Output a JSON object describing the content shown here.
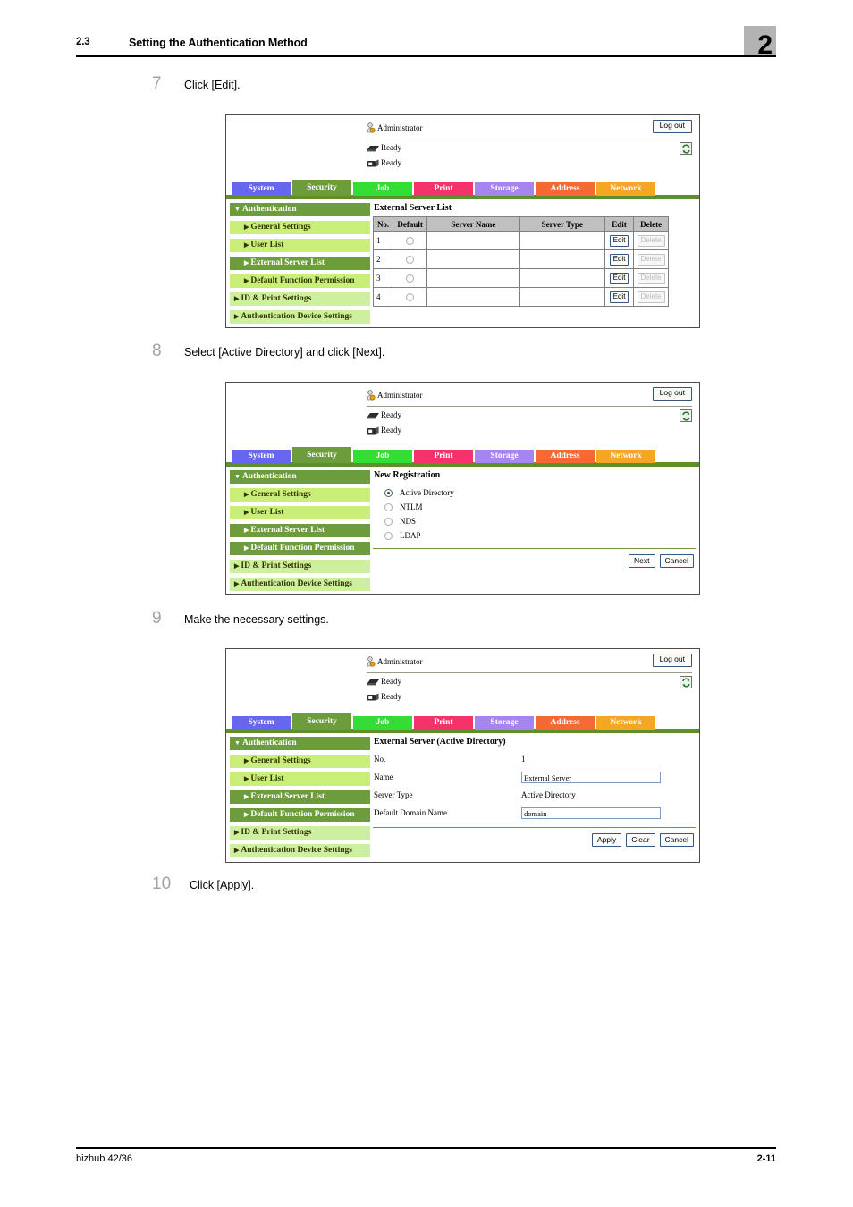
{
  "header": {
    "section_number": "2.3",
    "section_title": "Setting the Authentication Method",
    "chapter_badge": "2"
  },
  "footer": {
    "product": "bizhub 42/36",
    "page_number": "2-11"
  },
  "colors": {
    "tab_system": "#6666ee",
    "tab_security": "#6d9c3c",
    "tab_job": "#33dd33",
    "tab_print": "#f5336b",
    "tab_storage": "#a884f0",
    "tab_address": "#f56a33",
    "tab_network": "#f5a623",
    "nav_active": "#6d9c3c",
    "nav_child": "#c9ef7a",
    "nav_parent": "#cdf0a0",
    "green_bar": "#5f8f2c",
    "table_header": "#c0c0c0"
  },
  "steps": [
    {
      "number": "7",
      "text": "Click [Edit]."
    },
    {
      "number": "8",
      "text": "Select [Active Directory] and click [Next]."
    },
    {
      "number": "9",
      "text": "Make the necessary settings."
    },
    {
      "number": "10",
      "text": "Click [Apply]."
    }
  ],
  "web_ui": {
    "user_label": "Administrator",
    "logout_label": "Log out",
    "status_lines": [
      "Ready",
      "Ready"
    ],
    "tabs": [
      {
        "label": "System",
        "color": "#6666ee",
        "selected": false
      },
      {
        "label": "Security",
        "color": "#6d9c3c",
        "selected": true
      },
      {
        "label": "Job",
        "color": "#33dd33",
        "selected": false
      },
      {
        "label": "Print",
        "color": "#f5336b",
        "selected": false
      },
      {
        "label": "Storage",
        "color": "#a884f0",
        "selected": false
      },
      {
        "label": "Address",
        "color": "#f56a33",
        "selected": false
      },
      {
        "label": "Network",
        "color": "#f5a623",
        "selected": false
      }
    ],
    "nav": [
      {
        "label": "Authentication",
        "level": "root",
        "caret": "▼",
        "active": true
      },
      {
        "label": "General Settings",
        "level": "child",
        "caret": "▶",
        "active": false
      },
      {
        "label": "User List",
        "level": "child",
        "caret": "▶",
        "active": false
      },
      {
        "label": "External Server List",
        "level": "child",
        "caret": "▶",
        "active": true
      },
      {
        "label": "Default Function Permission",
        "level": "child",
        "caret": "▶",
        "active": false
      },
      {
        "label": "ID & Print Settings",
        "level": "parent",
        "caret": "▶",
        "active": false
      },
      {
        "label": "Authentication Device Settings",
        "level": "parent",
        "caret": "▶",
        "active": false
      }
    ]
  },
  "screen7": {
    "panel_title": "External Server List",
    "columns": [
      "No.",
      "Default",
      "Server Name",
      "Server Type",
      "Edit",
      "Delete"
    ],
    "rows": [
      {
        "no": "1",
        "default_selected": false,
        "server_name": "",
        "server_type": "",
        "edit": "Edit",
        "delete": "Delete",
        "delete_disabled": true
      },
      {
        "no": "2",
        "default_selected": false,
        "server_name": "",
        "server_type": "",
        "edit": "Edit",
        "delete": "Delete",
        "delete_disabled": true
      },
      {
        "no": "3",
        "default_selected": false,
        "server_name": "",
        "server_type": "",
        "edit": "Edit",
        "delete": "Delete",
        "delete_disabled": true
      },
      {
        "no": "4",
        "default_selected": false,
        "server_name": "",
        "server_type": "",
        "edit": "Edit",
        "delete": "Delete",
        "delete_disabled": true
      }
    ]
  },
  "screen8": {
    "panel_title": "New Registration",
    "options": [
      {
        "label": "Active Directory",
        "selected": true
      },
      {
        "label": "NTLM",
        "selected": false
      },
      {
        "label": "NDS",
        "selected": false
      },
      {
        "label": "LDAP",
        "selected": false
      }
    ],
    "buttons": [
      "Next",
      "Cancel"
    ]
  },
  "screen9": {
    "panel_title": "External Server (Active Directory)",
    "fields": [
      {
        "label": "No.",
        "value": "1",
        "input": false
      },
      {
        "label": "Name",
        "value": "External Server",
        "input": true
      },
      {
        "label": "Server Type",
        "value": "Active Directory",
        "input": false
      },
      {
        "label": "Default Domain Name",
        "value": "domain",
        "input": true
      }
    ],
    "buttons": [
      "Apply",
      "Clear",
      "Cancel"
    ]
  }
}
